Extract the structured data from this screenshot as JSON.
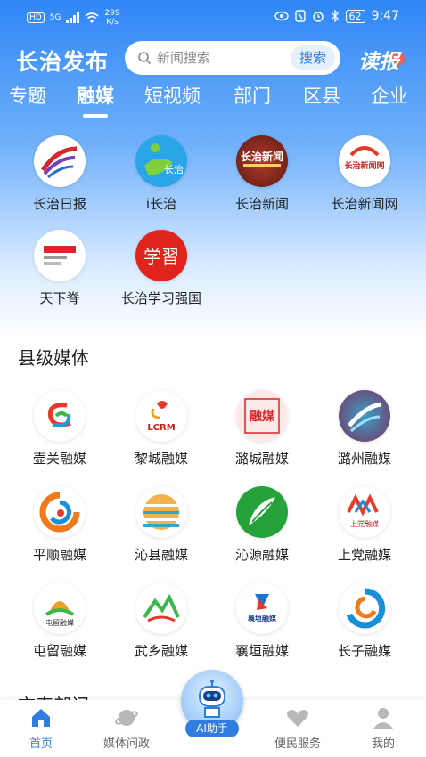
{
  "status_bar": {
    "hd": "HD",
    "net": "5G",
    "speed_value": "299",
    "speed_unit": "K/s",
    "battery": "62",
    "time": "9:47"
  },
  "header": {
    "app_title": "长治发布",
    "search_placeholder": "新闻搜索",
    "search_button": "搜索",
    "read_paper": "读报"
  },
  "tabs": [
    "专题",
    "融媒",
    "短视频",
    "部门",
    "区县",
    "企业"
  ],
  "active_tab": "融媒",
  "media": [
    {
      "label": "长治日报",
      "icon": "changzhi-daily-logo"
    },
    {
      "label": "i长治",
      "icon": "i-changzhi-logo"
    },
    {
      "label": "长治新闻",
      "icon": "changzhi-news-logo"
    },
    {
      "label": "长治新闻网",
      "icon": "changzhi-news-web-logo"
    },
    {
      "label": "天下脊",
      "icon": "tianxiaji-logo"
    },
    {
      "label": "长治学习强国",
      "icon": "xuexi-logo"
    }
  ],
  "county_section_title": "县级媒体",
  "county_media": [
    {
      "label": "壶关融媒"
    },
    {
      "label": "黎城融媒"
    },
    {
      "label": "潞城融媒"
    },
    {
      "label": "潞州融媒"
    },
    {
      "label": "平顺融媒"
    },
    {
      "label": "沁县融媒"
    },
    {
      "label": "沁源融媒"
    },
    {
      "label": "上党融媒"
    },
    {
      "label": "屯留融媒"
    },
    {
      "label": "武乡融媒"
    },
    {
      "label": "襄垣融媒"
    },
    {
      "label": "长子融媒"
    }
  ],
  "logo_text": {
    "changzhi_news": "长治新闻",
    "changzhi_news_web": "长治新闻网",
    "xuexi": "学習",
    "lucheng": "融媒",
    "licheng": "LCRM",
    "xiangyuan": "襄垣融媒",
    "tunliu": "屯留融媒",
    "shangdang": "上党融媒",
    "i_changzhi": "长治"
  },
  "next_section_title": "市直部门",
  "bottom_nav": [
    {
      "label": "首页",
      "icon": "home-icon"
    },
    {
      "label": "媒体问政",
      "icon": "planet-icon"
    },
    {
      "label": "便民服务",
      "icon": "heart-hands-icon"
    },
    {
      "label": "我的",
      "icon": "user-icon"
    }
  ],
  "ai_button": "AI助手",
  "colors": {
    "primary": "#2f7de0",
    "header_gradient_top": "#2f86f6"
  }
}
